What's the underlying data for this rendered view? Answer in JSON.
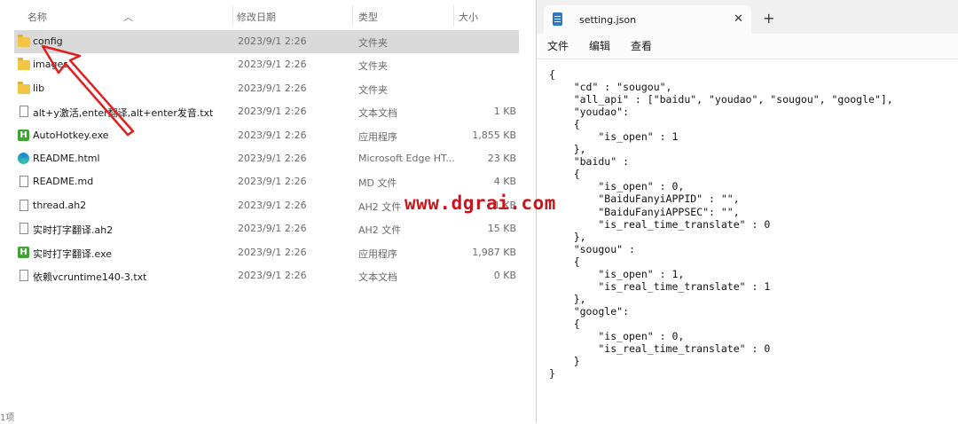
{
  "explorer": {
    "columns": {
      "name": "名称",
      "modified": "修改日期",
      "type": "类型",
      "size": "大小"
    },
    "files": [
      {
        "name": "config",
        "date": "2023/9/1 2:26",
        "type": "文件夹",
        "size": "",
        "icon": "folder-icon",
        "selected": true
      },
      {
        "name": "images",
        "date": "2023/9/1 2:26",
        "type": "文件夹",
        "size": "",
        "icon": "folder-icon"
      },
      {
        "name": "lib",
        "date": "2023/9/1 2:26",
        "type": "文件夹",
        "size": "",
        "icon": "folder-icon"
      },
      {
        "name": "alt+y激活,enter翻译,alt+enter发音.txt",
        "date": "2023/9/1 2:26",
        "type": "文本文档",
        "size": "1 KB",
        "icon": "text-file-icon"
      },
      {
        "name": "AutoHotkey.exe",
        "date": "2023/9/1 2:26",
        "type": "应用程序",
        "size": "1,855 KB",
        "icon": "autohotkey-icon"
      },
      {
        "name": "README.html",
        "date": "2023/9/1 2:26",
        "type": "Microsoft Edge HT...",
        "size": "23 KB",
        "icon": "edge-icon"
      },
      {
        "name": "README.md",
        "date": "2023/9/1 2:26",
        "type": "MD 文件",
        "size": "4 KB",
        "icon": "file-icon"
      },
      {
        "name": "thread.ah2",
        "date": "2023/9/1 2:26",
        "type": "AH2 文件",
        "size": "1 KB",
        "icon": "file-icon"
      },
      {
        "name": "实时打字翻译.ah2",
        "date": "2023/9/1 2:26",
        "type": "AH2 文件",
        "size": "15 KB",
        "icon": "file-icon"
      },
      {
        "name": "实时打字翻译.exe",
        "date": "2023/9/1 2:26",
        "type": "应用程序",
        "size": "1,987 KB",
        "icon": "autohotkey-icon"
      },
      {
        "name": "依赖vcruntime140-3.txt",
        "date": "2023/9/1 2:26",
        "type": "文本文档",
        "size": "0 KB",
        "icon": "text-file-icon"
      }
    ],
    "status_fragment": "1项"
  },
  "notepad": {
    "tab_title": "setting.json",
    "close_glyph": "✕",
    "new_tab_glyph": "+",
    "menu": {
      "file": "文件",
      "edit": "编辑",
      "view": "查看"
    },
    "content": "{\n    \"cd\" : \"sougou\",\n    \"all_api\" : [\"baidu\", \"youdao\", \"sougou\", \"google\"],\n    \"youdao\":\n    {\n        \"is_open\" : 1\n    },\n    \"baidu\" :\n    {\n        \"is_open\" : 0,\n        \"BaiduFanyiAPPID\" : \"\",\n        \"BaiduFanyiAPPSEC\": \"\",\n        \"is_real_time_translate\" : 0\n    },\n    \"sougou\" :\n    {\n        \"is_open\" : 1,\n        \"is_real_time_translate\" : 1\n    },\n    \"google\":\n    {\n        \"is_open\" : 0,\n        \"is_real_time_translate\" : 0\n    }\n}"
  },
  "watermark": "www.dgrai.com",
  "colors": {
    "selection": "#d9d9d9",
    "watermark": "#c8161d",
    "arrow": "#e02020"
  }
}
